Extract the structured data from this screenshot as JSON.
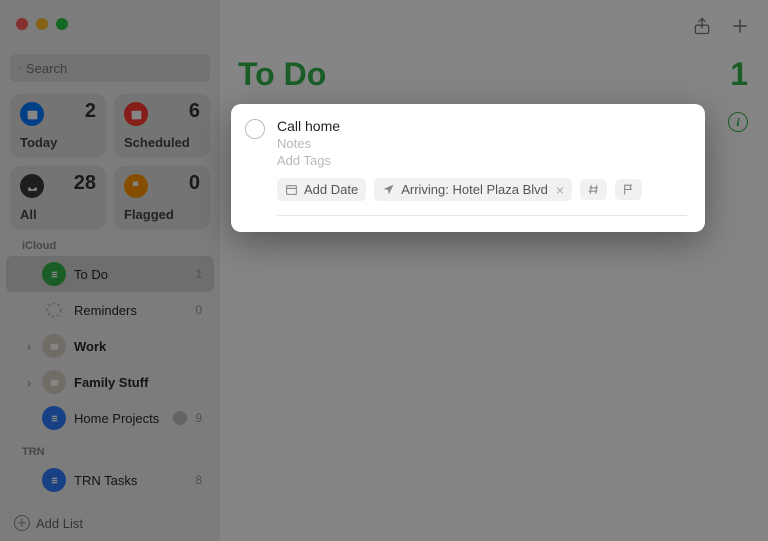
{
  "search": {
    "placeholder": "Search"
  },
  "smartLists": {
    "today": {
      "label": "Today",
      "count": "2"
    },
    "scheduled": {
      "label": "Scheduled",
      "count": "6"
    },
    "all": {
      "label": "All",
      "count": "28"
    },
    "flagged": {
      "label": "Flagged",
      "count": "0"
    }
  },
  "sections": {
    "icloud": {
      "label": "iCloud",
      "lists": {
        "todo": {
          "name": "To Do",
          "count": "1"
        },
        "reminders": {
          "name": "Reminders",
          "count": "0"
        },
        "work": {
          "name": "Work",
          "count": ""
        },
        "family": {
          "name": "Family Stuff",
          "count": ""
        },
        "home": {
          "name": "Home Projects",
          "count": "9"
        }
      }
    },
    "trn": {
      "label": "TRN",
      "lists": {
        "tasks": {
          "name": "TRN Tasks",
          "count": "8"
        }
      }
    }
  },
  "addList": {
    "label": "Add List"
  },
  "main": {
    "title": "To Do",
    "count": "1"
  },
  "popover": {
    "title": "Call home",
    "notes_placeholder": "Notes",
    "tags_placeholder": "Add Tags",
    "chips": {
      "add_date": "Add Date",
      "location": "Arriving: Hotel Plaza Blvd"
    }
  }
}
